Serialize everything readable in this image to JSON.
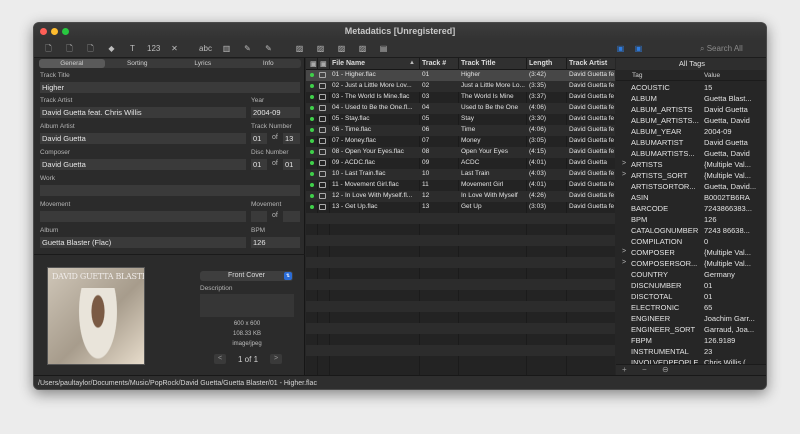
{
  "window": {
    "title": "Metadatics [Unregistered]",
    "lights": {
      "close": "#ff5f57",
      "min": "#febc2e",
      "max": "#28c840"
    }
  },
  "toolbar": {
    "search_placeholder": "Search All",
    "icons": [
      "add-file-icon",
      "add-folder-icon",
      "remove-file-icon",
      "tag-icon",
      "text-icon",
      "number-icon",
      "tools-icon",
      "spacer",
      "abc-icon",
      "library-icon",
      "rename-icon",
      "clean-icon",
      "spacer",
      "image-icon",
      "image-add-icon",
      "image-remove-icon",
      "image-export-icon",
      "save-icon"
    ]
  },
  "tabs": [
    "General",
    "Sorting",
    "Lyrics",
    "Info"
  ],
  "fields": {
    "track_title_label": "Track Title",
    "track_title": "Higher",
    "track_artist_label": "Track Artist",
    "track_artist": "David Guetta feat. Chris Willis",
    "year_label": "Year",
    "year": "2004-09",
    "album_artist_label": "Album Artist",
    "album_artist": "David Guetta",
    "track_number_label": "Track Number",
    "track_number": "01",
    "track_total": "13",
    "composer_label": "Composer",
    "composer": "David Guetta",
    "disc_number_label": "Disc Number",
    "disc_number": "01",
    "disc_total": "01",
    "work_label": "Work",
    "work": "",
    "movement_label": "Movement",
    "movement": "",
    "movement2_label": "Movement",
    "movement_num": "",
    "movement_total": "",
    "album_label": "Album",
    "album": "Guetta Blaster  (Flac)",
    "bpm_label": "BPM",
    "bpm": "126",
    "of": "of"
  },
  "artwork": {
    "cover_text": "DAVID GUETTA BLASTER",
    "type_select": "Front Cover",
    "description_label": "Description",
    "dimensions": "600 x 600",
    "size": "108.33 KB",
    "mime": "image/jpeg",
    "pager": "1 of 1",
    "prev": "<",
    "next": ">"
  },
  "file_table": {
    "headers": {
      "file_name": "File Name",
      "track_no": "Track #",
      "track_title": "Track Title",
      "length": "Length",
      "track_artist": "Track Artist"
    },
    "rows": [
      {
        "file": "01 - Higher.flac",
        "num": "01",
        "title": "Higher",
        "len": "(3:42)",
        "artist": "David Guetta fe"
      },
      {
        "file": "02 - Just a Little More Lov...",
        "num": "02",
        "title": "Just a Little More Lo...",
        "len": "(3:35)",
        "artist": "David Guetta fe"
      },
      {
        "file": "03 - The World Is Mine.flac",
        "num": "03",
        "title": "The World Is Mine",
        "len": "(3:37)",
        "artist": "David Guetta fe"
      },
      {
        "file": "04 - Used to Be the One.fl...",
        "num": "04",
        "title": "Used to Be the One",
        "len": "(4:06)",
        "artist": "David Guetta fe"
      },
      {
        "file": "05 - Stay.flac",
        "num": "05",
        "title": "Stay",
        "len": "(3:30)",
        "artist": "David Guetta fe"
      },
      {
        "file": "06 - Time.flac",
        "num": "06",
        "title": "Time",
        "len": "(4:06)",
        "artist": "David Guetta fe"
      },
      {
        "file": "07 - Money.flac",
        "num": "07",
        "title": "Money",
        "len": "(3:05)",
        "artist": "David Guetta fe"
      },
      {
        "file": "08 - Open Your Eyes.flac",
        "num": "08",
        "title": "Open Your Eyes",
        "len": "(4:15)",
        "artist": "David Guetta fe"
      },
      {
        "file": "09 - ACDC.flac",
        "num": "09",
        "title": "ACDC",
        "len": "(4:01)",
        "artist": "David Guetta"
      },
      {
        "file": "10 - Last Train.flac",
        "num": "10",
        "title": "Last Train",
        "len": "(4:03)",
        "artist": "David Guetta fe"
      },
      {
        "file": "11 - Movement Girl.flac",
        "num": "11",
        "title": "Movement Girl",
        "len": "(4:01)",
        "artist": "David Guetta fe"
      },
      {
        "file": "12 - In Love With Myself.fl...",
        "num": "12",
        "title": "In Love With Myself",
        "len": "(4:26)",
        "artist": "David Guetta fe"
      },
      {
        "file": "13 - Get Up.flac",
        "num": "13",
        "title": "Get Up",
        "len": "(3:03)",
        "artist": "David Guetta fe"
      }
    ],
    "status_color": "#3fd04a"
  },
  "all_tags": {
    "title": "All Tags",
    "col_tag": "Tag",
    "col_value": "Value",
    "rows": [
      {
        "tag": "ACOUSTIC",
        "value": "15",
        "exp": ""
      },
      {
        "tag": "ALBUM",
        "value": "Guetta Blast...",
        "exp": ""
      },
      {
        "tag": "ALBUM_ARTISTS",
        "value": "David Guetta",
        "exp": ""
      },
      {
        "tag": "ALBUM_ARTISTS...",
        "value": "Guetta, David",
        "exp": ""
      },
      {
        "tag": "ALBUM_YEAR",
        "value": "2004-09",
        "exp": ""
      },
      {
        "tag": "ALBUMARTIST",
        "value": "David Guetta",
        "exp": ""
      },
      {
        "tag": "ALBUMARTISTS...",
        "value": "Guetta, David",
        "exp": ""
      },
      {
        "tag": "ARTISTS",
        "value": "{Multiple Val...",
        "exp": ">"
      },
      {
        "tag": "ARTISTS_SORT",
        "value": "{Multiple Val...",
        "exp": ">"
      },
      {
        "tag": "ARTISTSORTOR...",
        "value": "Guetta, David...",
        "exp": ""
      },
      {
        "tag": "ASIN",
        "value": "B0002TB6RA",
        "exp": ""
      },
      {
        "tag": "BARCODE",
        "value": "7243866383...",
        "exp": ""
      },
      {
        "tag": "BPM",
        "value": "126",
        "exp": ""
      },
      {
        "tag": "CATALOGNUMBER",
        "value": "7243 86638...",
        "exp": ""
      },
      {
        "tag": "COMPILATION",
        "value": "0",
        "exp": ""
      },
      {
        "tag": "COMPOSER",
        "value": "{Multiple Val...",
        "exp": ">"
      },
      {
        "tag": "COMPOSERSOR...",
        "value": "{Multiple Val...",
        "exp": ">"
      },
      {
        "tag": "COUNTRY",
        "value": "Germany",
        "exp": ""
      },
      {
        "tag": "DISCNUMBER",
        "value": "01",
        "exp": ""
      },
      {
        "tag": "DISCTOTAL",
        "value": "01",
        "exp": ""
      },
      {
        "tag": "ELECTRONIC",
        "value": "65",
        "exp": ""
      },
      {
        "tag": "ENGINEER",
        "value": "Joachim Garr...",
        "exp": ""
      },
      {
        "tag": "ENGINEER_SORT",
        "value": "Garraud, Joa...",
        "exp": ""
      },
      {
        "tag": "FBPM",
        "value": "126.9189",
        "exp": ""
      },
      {
        "tag": "INSTRUMENTAL",
        "value": "23",
        "exp": ""
      },
      {
        "tag": "INVOLVEDPEOPLE",
        "value": "Chris Willis (...",
        "exp": ""
      }
    ],
    "footer": {
      "add": "+",
      "remove": "−",
      "more": "⊖"
    }
  },
  "status_path": "/Users/paultaylor/Documents/Music/PopRock/David Guetta/Guetta Blaster/01 - Higher.flac"
}
